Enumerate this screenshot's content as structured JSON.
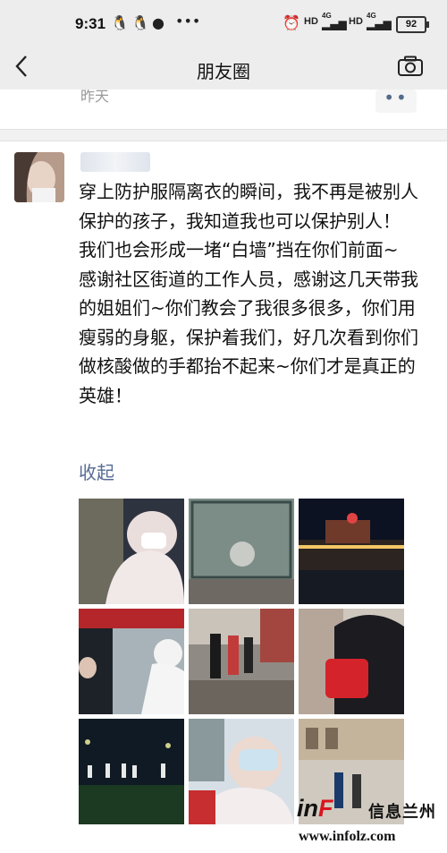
{
  "status_bar": {
    "time": "9:31",
    "notification_icons": [
      "qq-icon",
      "qq-icon",
      "drop-icon",
      "more-dots-icon"
    ],
    "dots": "•••",
    "network_label_1": "HD",
    "network_label_2": "HD",
    "signal_label": "4G",
    "battery": "92"
  },
  "nav": {
    "back_icon": "chevron-left-icon",
    "title": "朋友圈",
    "camera_icon": "camera-icon"
  },
  "previous_post": {
    "time": "昨天",
    "more": "••"
  },
  "post": {
    "text": "穿上防护服隔离衣的瞬间，我不再是被别人保护的孩子，我知道我也可以保护别人！\n我们也会形成一堵“白墙”挡在你们前面~\n感谢社区街道的工作人员，感谢这几天带我的姐姐们~你们教会了我很多很多，你们用瘦弱的身躯，保护着我们，好几次看到你们做核酸做的手都抬不起来~你们才是真正的英雄！",
    "collapse_label": "收起",
    "photo_count": 9
  },
  "colors": {
    "link": "#576b95",
    "bar_bg": "#ededed",
    "watermark_red": "#d8151f"
  },
  "watermark": {
    "brand_in": "in",
    "brand_f": "F",
    "brand_cn": "信息兰州",
    "url": "www.infolz.com"
  }
}
